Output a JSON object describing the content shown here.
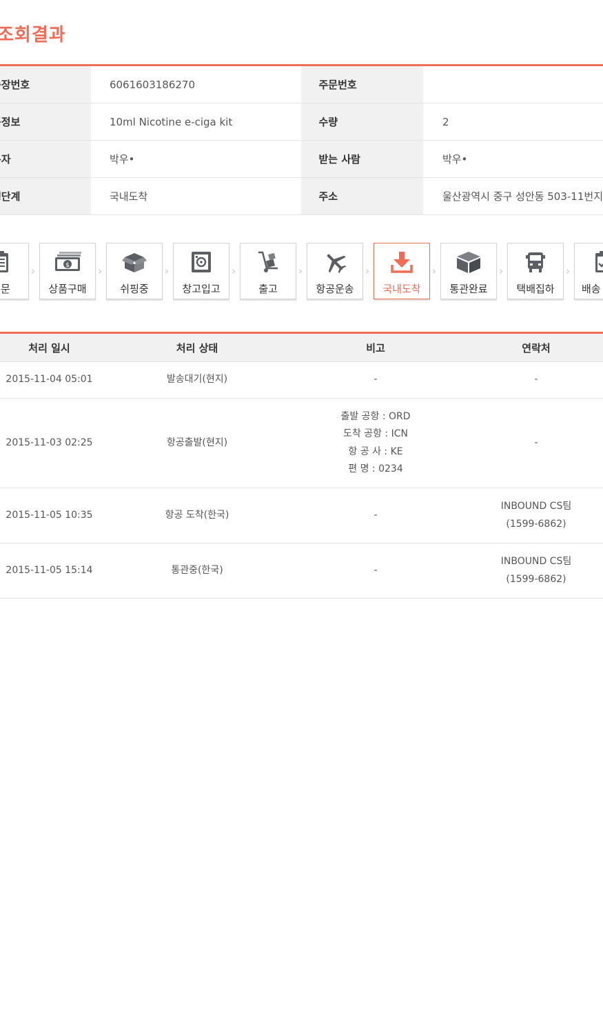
{
  "title": "조회결과",
  "info": {
    "rows": [
      {
        "label1": "송장번호",
        "value1": "6061603186270",
        "label2": "주문번호",
        "value2": ""
      },
      {
        "label1": "품정보",
        "value1": "10ml Nicotine e-ciga kit",
        "label2": "수량",
        "value2": "2"
      },
      {
        "label1": "문자",
        "value1": "박우•",
        "label2": "받는 사람",
        "value2": "박우•"
      },
      {
        "label1": "행단계",
        "value1": "국내도착",
        "label2": "주소",
        "value2": "울산광역시 중구 성안동 503-11번지"
      }
    ]
  },
  "steps": [
    {
      "label": "주문",
      "icon": "clipboard-icon"
    },
    {
      "label": "상품구매",
      "icon": "money-icon"
    },
    {
      "label": "쉬핑중",
      "icon": "box-open-icon"
    },
    {
      "label": "창고입고",
      "icon": "safe-icon"
    },
    {
      "label": "출고",
      "icon": "hand-truck-icon"
    },
    {
      "label": "항공운송",
      "icon": "airplane-icon"
    },
    {
      "label": "국내도착",
      "icon": "download-arrow-icon",
      "active": true
    },
    {
      "label": "통관완료",
      "icon": "package-icon"
    },
    {
      "label": "택배집하",
      "icon": "truck-icon"
    },
    {
      "label": "배송",
      "icon": "clipboard-check-icon"
    }
  ],
  "history": {
    "headers": [
      "처리 일시",
      "처리 상태",
      "비고",
      "연락처"
    ],
    "rows": [
      {
        "date": "2015-11-04 05:01",
        "status": "발송대기(현지)",
        "note": [
          "-"
        ],
        "contact": [
          "-"
        ]
      },
      {
        "date": "2015-11-03 02:25",
        "status": "항공출발(현지)",
        "note": [
          "출발 공항 : ORD",
          "도착 공항 : ICN",
          "항 공 사 : KE",
          "편 명 : 0234"
        ],
        "contact": [
          "-"
        ]
      },
      {
        "date": "2015-11-05 10:35",
        "status": "항공 도착(한국)",
        "note": [
          "-"
        ],
        "contact": [
          "INBOUND CS팀",
          "(1599-6862)"
        ]
      },
      {
        "date": "2015-11-05 15:14",
        "status": "통관중(한국)",
        "note": [
          "-"
        ],
        "contact": [
          "INBOUND CS팀",
          "(1599-6862)"
        ]
      }
    ]
  },
  "colors": {
    "accent": "#ef6c57",
    "label_bg": "#f1f1f1"
  }
}
